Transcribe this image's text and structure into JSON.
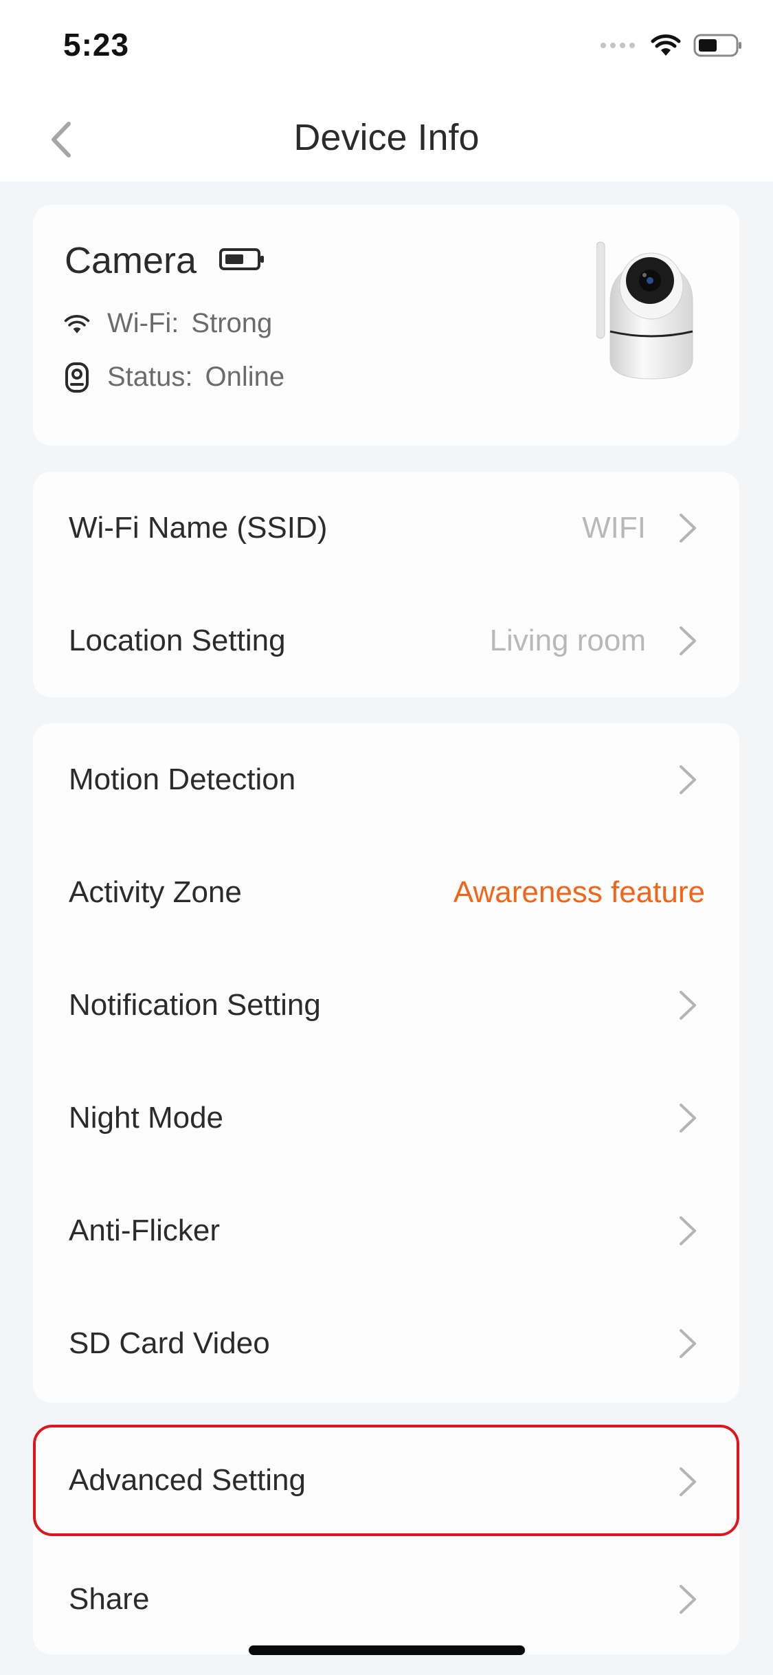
{
  "status_bar": {
    "time": "5:23"
  },
  "nav": {
    "title": "Device Info"
  },
  "device": {
    "name": "Camera",
    "wifi_label": "Wi-Fi:",
    "wifi_value": "Strong",
    "status_label": "Status:",
    "status_value": "Online"
  },
  "group1": {
    "items": [
      {
        "label": "Wi-Fi Name (SSID)",
        "value": "WIFI"
      },
      {
        "label": "Location Setting",
        "value": "Living room"
      }
    ]
  },
  "group2": {
    "items": [
      {
        "label": "Motion Detection",
        "value": ""
      },
      {
        "label": "Activity Zone",
        "value": "Awareness feature"
      },
      {
        "label": "Notification Setting",
        "value": ""
      },
      {
        "label": "Night Mode",
        "value": ""
      },
      {
        "label": "Anti-Flicker",
        "value": ""
      },
      {
        "label": "SD Card Video",
        "value": ""
      }
    ]
  },
  "group3": {
    "items": [
      {
        "label": "Advanced Setting"
      },
      {
        "label": "Share"
      }
    ]
  },
  "colors": {
    "accent_orange": "#f26418",
    "highlight_red": "#e0141c",
    "background": "#f4f5f7",
    "card": "#fdfdfd"
  }
}
